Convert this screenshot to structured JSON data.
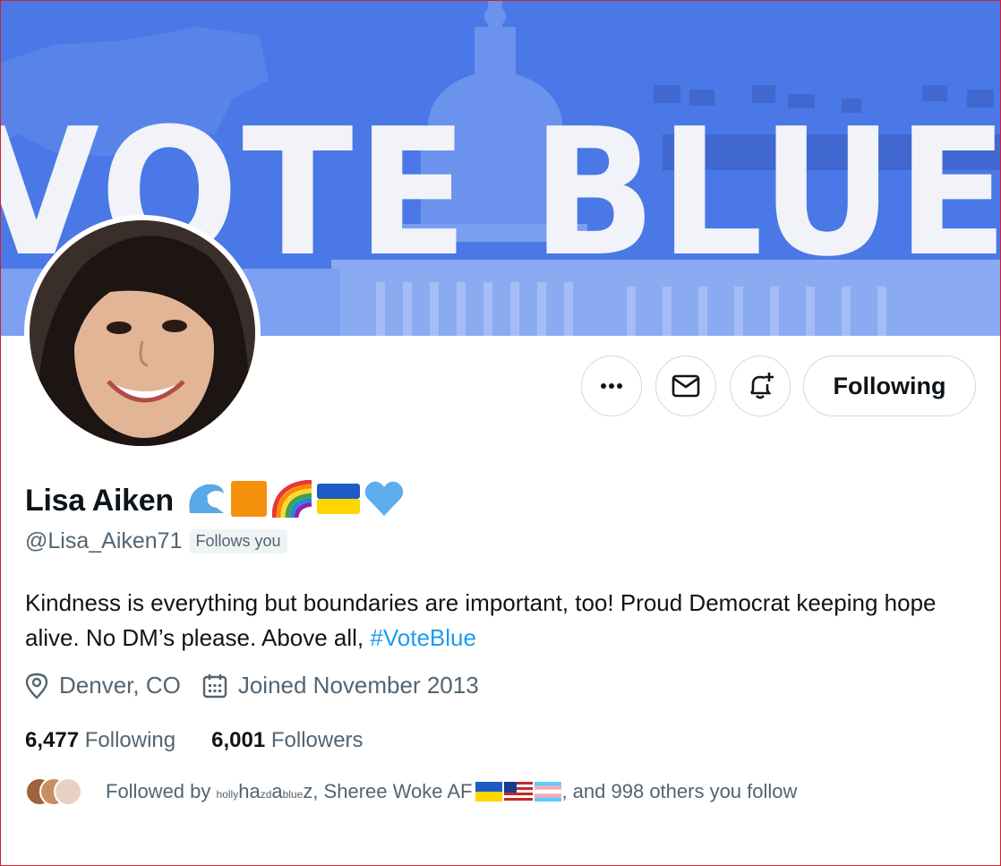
{
  "banner": {
    "text": "VOTE BLUE",
    "background": "#4a78e6"
  },
  "profile": {
    "name": "Lisa Aiken",
    "name_emojis": [
      "wave-icon",
      "orange-square-icon",
      "rainbow-icon",
      "ukraine-flag-icon",
      "blue-heart-icon"
    ],
    "handle": "@Lisa_Aiken71",
    "follows_you": "Follows you",
    "bio_text": "Kindness is everything but boundaries are important, too! Proud Democrat keeping hope alive. No DM’s please. Above all, ",
    "bio_hashtag": "#VoteBlue",
    "location": "Denver, CO",
    "joined": "Joined November 2013",
    "following_count": "6,477",
    "following_label": "Following",
    "followers_count": "6,001",
    "followers_label": "Followers"
  },
  "actions": {
    "following_button": "Following"
  },
  "followed_by": {
    "prefix": "Followed by ",
    "name1_parts": [
      "holly",
      "ha",
      "zd",
      "a",
      "blue",
      "z"
    ],
    "name2": "Sheree Woke AF ",
    "suffix": ", and 998 others you follow"
  },
  "colors": {
    "accent": "#1d9bf0",
    "secondary_text": "#536471",
    "border": "#cfd9de"
  }
}
